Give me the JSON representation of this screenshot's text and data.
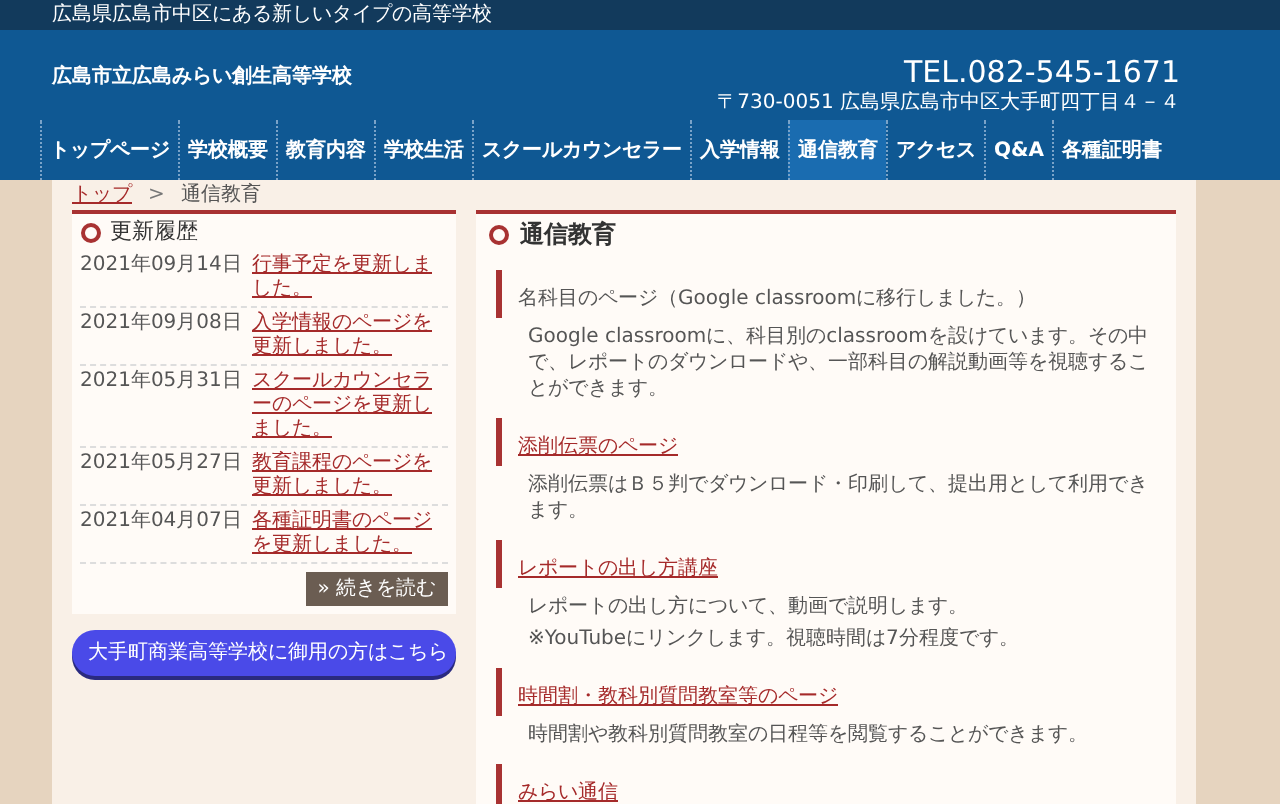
{
  "top_bar": {
    "tagline": "広島県広島市中区にある新しいタイプの高等学校"
  },
  "header": {
    "school_name": "広島市立広島みらい創生高等学校",
    "tel": "TEL.082-545-1671",
    "address": "〒730-0051 広島県広島市中区大手町四丁目４－４"
  },
  "nav": [
    {
      "label": "トップページ",
      "selected": false
    },
    {
      "label": "学校概要",
      "selected": false
    },
    {
      "label": "教育内容",
      "selected": false
    },
    {
      "label": "学校生活",
      "selected": false
    },
    {
      "label": "スクールカウンセラー",
      "selected": false
    },
    {
      "label": "入学情報",
      "selected": false
    },
    {
      "label": "通信教育",
      "selected": true
    },
    {
      "label": "アクセス",
      "selected": false
    },
    {
      "label": "Q&A",
      "selected": false
    },
    {
      "label": "各種証明書",
      "selected": false
    }
  ],
  "breadcrumb": {
    "link": "トップ",
    "separator": ">",
    "current": "通信教育"
  },
  "updates": {
    "title": "更新履歴",
    "items": [
      {
        "date": "2021年09月14日",
        "text": "行事予定を更新しました。"
      },
      {
        "date": "2021年09月08日",
        "text": "入学情報のページを更新しました。"
      },
      {
        "date": "2021年05月31日",
        "text": "スクールカウンセラーのページを更新しました。"
      },
      {
        "date": "2021年05月27日",
        "text": "教育課程のページを更新しました。"
      },
      {
        "date": "2021年04月07日",
        "text": "各種証明書のページを更新しました。"
      }
    ],
    "more_button": "» 続きを読む"
  },
  "banner_button": "大手町商業高等学校に御用の方はこちら",
  "main": {
    "title": "通信教育",
    "sections": [
      {
        "heading": "名科目のページ（Google classroomに移行しました。）",
        "link": false,
        "lines": [
          "Google classroomに、科目別のclassroomを設けています。その中で、レポートのダウンロードや、一部科目の解説動画等を視聴することができます。"
        ]
      },
      {
        "heading": "添削伝票のページ",
        "link": true,
        "lines": [
          "添削伝票はＢ５判でダウンロード・印刷して、提出用として利用できます。"
        ]
      },
      {
        "heading": "レポートの出し方講座",
        "link": true,
        "lines": [
          "レポートの出し方について、動画で説明します。",
          "※YouTubeにリンクします。視聴時間は7分程度です。"
        ]
      },
      {
        "heading": "時間割・教科別質問教室等のページ",
        "link": true,
        "lines": [
          "時間割や教科別質問教室の日程等を閲覧することができます。"
        ]
      },
      {
        "heading": "みらい通信",
        "link": true
      }
    ]
  }
}
